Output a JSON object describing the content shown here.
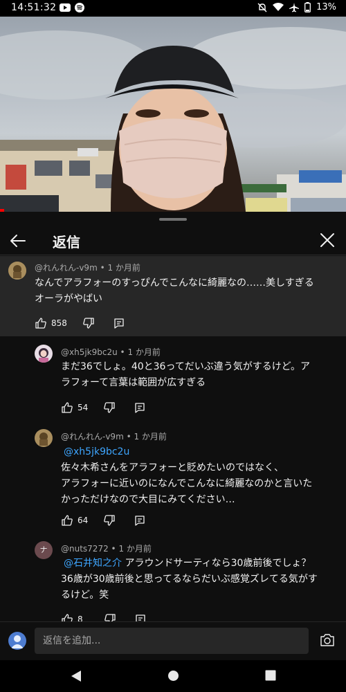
{
  "status_bar": {
    "time": "14:51:32",
    "battery": "13%"
  },
  "panel": {
    "title": "返信"
  },
  "main_comment": {
    "author": "@れんれん-v9m",
    "age": "1 か月前",
    "text_line1": "なんでアラフォーのすっぴんでこんなに綺麗なの……美しすぎる",
    "text_line2": "オーラがやばい",
    "likes": "858"
  },
  "replies": [
    {
      "author": "@xh5jk9bc2u",
      "age": "1 か月前",
      "lines": [
        "まだ36でしょ。40と36ってだいぶ違う気がするけど。ア",
        "ラフォーて言葉は範囲が広すぎる"
      ],
      "likes": "54"
    },
    {
      "author": "@れんれん-v9m",
      "age": "1 か月前",
      "mention": "@xh5jk9bc2u",
      "lines": [
        "佐々木希さんをアラフォーと貶めたいのではなく、",
        "アラフォーに近いのになんでこんなに綺麗なのかと言いた",
        "かっただけなので大目にみてください…"
      ],
      "likes": "64"
    },
    {
      "author": "@nuts7272",
      "age": "1 か月前",
      "avatar_letter": "ナ",
      "mention": "@石井知之介",
      "first_line_rest": " アラウンドサーティなら30歳前後でしょ？",
      "lines": [
        "36歳が30歳前後と思ってるならだいぶ感覚ズレてる気がす",
        "るけど。笑"
      ],
      "likes": "8"
    }
  ],
  "composer": {
    "placeholder": "返信を追加..."
  },
  "colors": {
    "background": "#0f0f0f",
    "highlight": "#272727",
    "mention": "#3ea6ff",
    "meta": "#aaaaaa"
  }
}
